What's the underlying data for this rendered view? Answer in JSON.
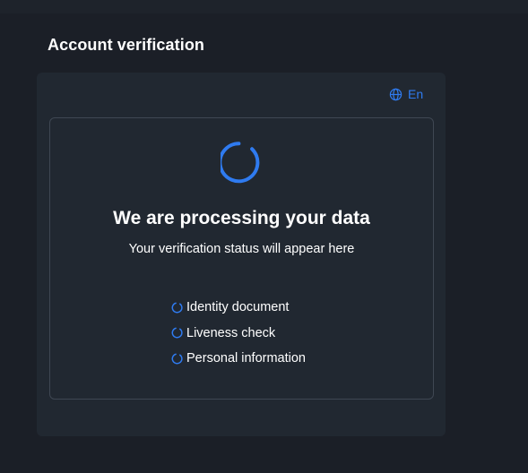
{
  "header": {
    "title": "Account verification"
  },
  "language": {
    "icon": "globe-icon",
    "label": "En"
  },
  "status": {
    "spinner_icon": "loading-spinner-icon",
    "heading": "We are processing your data",
    "subheading": "Your verification status will appear here"
  },
  "steps": [
    {
      "icon": "pending-spinner-icon",
      "label": "Identity document"
    },
    {
      "icon": "pending-spinner-icon",
      "label": "Liveness check"
    },
    {
      "icon": "pending-spinner-icon",
      "label": "Personal information"
    }
  ],
  "colors": {
    "accent": "#2f7bf0",
    "background": "#1b1f27",
    "card": "#212831",
    "border": "#3f4753",
    "text": "#ffffff"
  }
}
